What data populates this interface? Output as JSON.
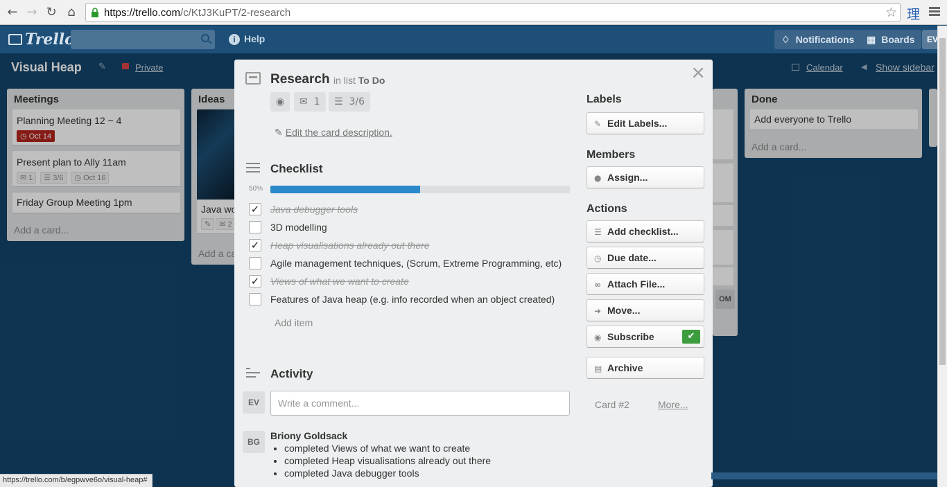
{
  "browser": {
    "url_host": "https://trello.com",
    "url_path": "/c/KtJ3KuPT/2-research",
    "status_url": "https://trello.com/b/egpwve6o/visual-heap#",
    "ext_glyph": "理"
  },
  "header": {
    "logo": "Trello",
    "help": "Help",
    "notifications": "Notifications",
    "boards": "Boards",
    "user_initials": "EV"
  },
  "board": {
    "title": "Visual Heap",
    "visibility": "Private",
    "calendar": "Calendar",
    "show_sidebar": "Show sidebar"
  },
  "lists": {
    "meetings": {
      "title": "Meetings",
      "cards": [
        {
          "title": "Planning Meeting 12 ~ 4",
          "due": "Oct 14"
        },
        {
          "title": "Present plan to Ally 11am",
          "comments": "1",
          "checklist": "3/6",
          "due": "Oct 16"
        },
        {
          "title": "Friday Group Meeting 1pm"
        }
      ],
      "add_card": "Add a card..."
    },
    "ideas": {
      "title": "Ideas",
      "card_title": "Java wo",
      "comments": "2",
      "add_card": "Add a ca"
    },
    "done": {
      "title": "Done",
      "cards": [
        {
          "title": "Add everyone to Trello"
        }
      ],
      "add_card": "Add a card..."
    },
    "hidden_member": "OM"
  },
  "modal": {
    "title": "Research",
    "in_list_prefix": "in list",
    "in_list": "To Do",
    "badges": {
      "comments": "1",
      "checklist": "3/6"
    },
    "edit_description": "Edit the card description.",
    "checklist": {
      "title": "Checklist",
      "percent": "50%",
      "progress": 0.5,
      "items": [
        {
          "text": "Java debugger tools",
          "done": true
        },
        {
          "text": "3D modelling",
          "done": false
        },
        {
          "text": "Heap visualisations already out there",
          "done": true
        },
        {
          "text": "Agile management techniques, (Scrum, Extreme Programming, etc)",
          "done": false
        },
        {
          "text": "Views of what we want to create",
          "done": true
        },
        {
          "text": "Features of Java heap (e.g. info recorded when an object created)",
          "done": false
        }
      ],
      "add_item": "Add item"
    },
    "activity": {
      "title": "Activity",
      "my_initials": "EV",
      "comment_placeholder": "Write a comment...",
      "entry": {
        "initials": "BG",
        "name": "Briony Goldsack",
        "items": [
          "completed Views of what we want to create",
          "completed Heap visualisations already out there",
          "completed Java debugger tools"
        ]
      }
    },
    "sidebar": {
      "labels_title": "Labels",
      "edit_labels": "Edit Labels...",
      "members_title": "Members",
      "assign": "Assign...",
      "actions_title": "Actions",
      "add_checklist": "Add checklist...",
      "due_date": "Due date...",
      "attach_file": "Attach File...",
      "move": "Move...",
      "subscribe": "Subscribe",
      "archive": "Archive",
      "card_number": "Card #2",
      "more": "More..."
    }
  },
  "colors": {
    "board_bg": "#13456b",
    "header_bg": "#1d4f78",
    "progress": "#2b88c9",
    "due_red": "#b3251e",
    "subscribe_green": "#3d9c3d"
  }
}
